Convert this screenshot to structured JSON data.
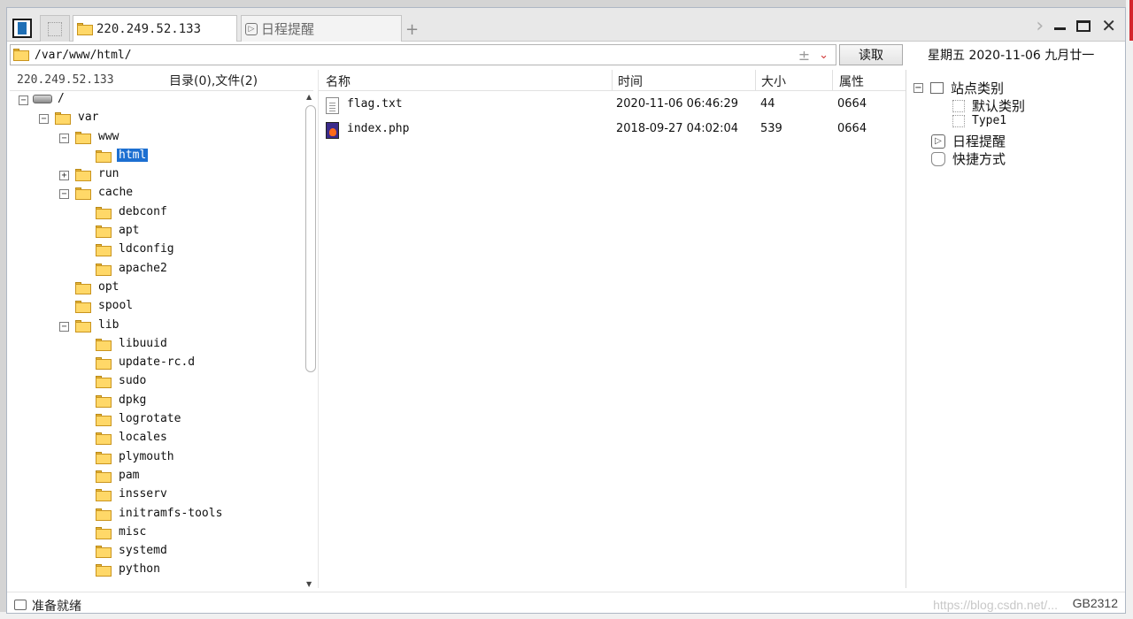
{
  "tabs": {
    "active_host": "220.249.52.133",
    "schedule": "日程提醒",
    "add": "+"
  },
  "address": {
    "path": "/var/www/html/",
    "read_button": "读取",
    "date_text": "星期五 2020-11-06 九月廿一"
  },
  "tree_header": {
    "host": "220.249.52.133",
    "counts": "目录(0),文件(2)"
  },
  "tree": [
    {
      "label": "/",
      "depth": 0,
      "toggle": "−",
      "icon": "drive-icon"
    },
    {
      "label": "var",
      "depth": 1,
      "toggle": "−"
    },
    {
      "label": "www",
      "depth": 2,
      "toggle": "−"
    },
    {
      "label": "html",
      "depth": 3,
      "toggle": "",
      "selected": true
    },
    {
      "label": "run",
      "depth": 2,
      "toggle": "+"
    },
    {
      "label": "cache",
      "depth": 2,
      "toggle": "−"
    },
    {
      "label": "debconf",
      "depth": 3,
      "toggle": ""
    },
    {
      "label": "apt",
      "depth": 3,
      "toggle": ""
    },
    {
      "label": "ldconfig",
      "depth": 3,
      "toggle": ""
    },
    {
      "label": "apache2",
      "depth": 3,
      "toggle": ""
    },
    {
      "label": "opt",
      "depth": 2,
      "toggle": ""
    },
    {
      "label": "spool",
      "depth": 2,
      "toggle": ""
    },
    {
      "label": "lib",
      "depth": 2,
      "toggle": "−"
    },
    {
      "label": "libuuid",
      "depth": 3,
      "toggle": ""
    },
    {
      "label": "update-rc.d",
      "depth": 3,
      "toggle": ""
    },
    {
      "label": "sudo",
      "depth": 3,
      "toggle": ""
    },
    {
      "label": "dpkg",
      "depth": 3,
      "toggle": ""
    },
    {
      "label": "logrotate",
      "depth": 3,
      "toggle": ""
    },
    {
      "label": "locales",
      "depth": 3,
      "toggle": ""
    },
    {
      "label": "plymouth",
      "depth": 3,
      "toggle": ""
    },
    {
      "label": "pam",
      "depth": 3,
      "toggle": ""
    },
    {
      "label": "insserv",
      "depth": 3,
      "toggle": ""
    },
    {
      "label": "initramfs-tools",
      "depth": 3,
      "toggle": ""
    },
    {
      "label": "misc",
      "depth": 3,
      "toggle": ""
    },
    {
      "label": "systemd",
      "depth": 3,
      "toggle": ""
    },
    {
      "label": "python",
      "depth": 3,
      "toggle": ""
    }
  ],
  "filelist": {
    "columns": {
      "name": "名称",
      "time": "时间",
      "size": "大小",
      "attr": "属性"
    },
    "rows": [
      {
        "name": "flag.txt",
        "time": "2020-11-06 06:46:29",
        "size": "44",
        "attr": "0664",
        "icon": "text-file-icon"
      },
      {
        "name": "index.php",
        "time": "2018-09-27 04:02:04",
        "size": "539",
        "attr": "0664",
        "icon": "php-file-icon"
      }
    ]
  },
  "side_panel": {
    "site_category": "站点类别",
    "default_category": "默认类别",
    "type1": "Type1",
    "schedule": "日程提醒",
    "shortcuts": "快捷方式"
  },
  "status": {
    "text": "准备就绪",
    "encoding": "GB2312",
    "watermark": "https://blog.csdn.net/..."
  }
}
